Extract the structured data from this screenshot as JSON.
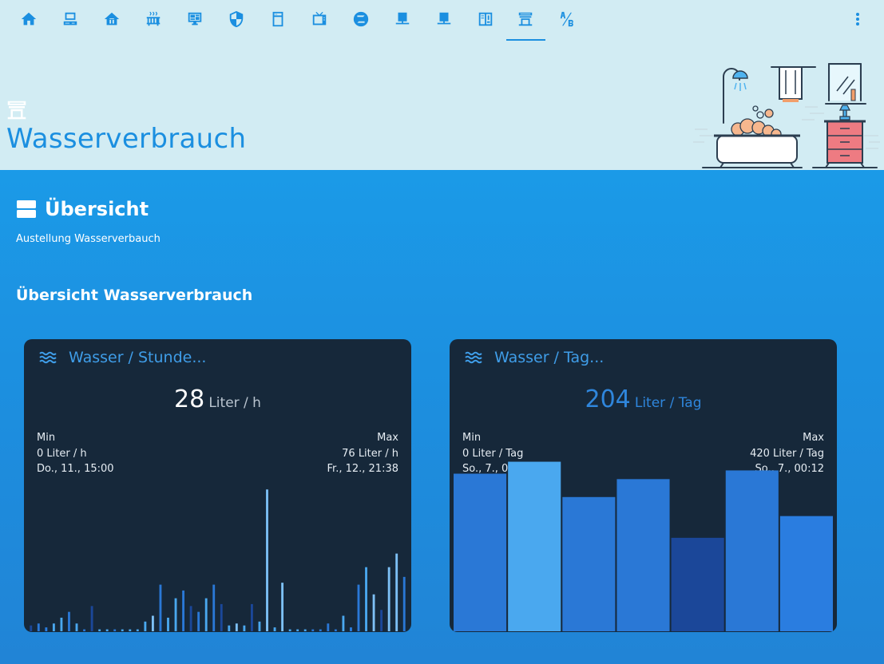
{
  "view": {
    "title": "Wasserverbrauch",
    "icon": "water-tap-icon"
  },
  "tabs": [
    {
      "name": "home-icon"
    },
    {
      "name": "computer-icon"
    },
    {
      "name": "house-icon"
    },
    {
      "name": "radiator-icon"
    },
    {
      "name": "monitor-dashboard-icon"
    },
    {
      "name": "shield-icon"
    },
    {
      "name": "washing-machine-icon"
    },
    {
      "name": "television-icon"
    },
    {
      "name": "zigbee-icon"
    },
    {
      "name": "laptop-icon"
    },
    {
      "name": "laptop-icon-2"
    },
    {
      "name": "panel-icon"
    },
    {
      "name": "water-tap-icon"
    },
    {
      "name": "alpha-ab-icon"
    }
  ],
  "active_tab": 12,
  "section": {
    "title": "Übersicht",
    "subtitle": "Austellung Wasserverbauch",
    "group_title": "Übersicht Wasserverbrauch"
  },
  "colors": {
    "header_bg": "#d2ecf3",
    "accent": "#1b8fe0",
    "card_bg": "#16283a",
    "bar_palette": [
      "#2a78d6",
      "#4aa8ef",
      "#7dc0f5",
      "#1b4799",
      "#2a7de0"
    ]
  },
  "cards": [
    {
      "name": "Wasser / Stunde...",
      "value": "28",
      "unit": "Liter / h",
      "value_color": "#ffffff",
      "unit_color": "#b9c4cf",
      "min_label": "Min",
      "min_value": "0 Liter / h",
      "min_time": "Do., 11., 15:00",
      "max_label": "Max",
      "max_value": "76 Liter / h",
      "max_time": "Fr., 12., 21:38"
    },
    {
      "name": "Wasser / Tag...",
      "value": "204",
      "unit": "Liter / Tag",
      "value_color": "#2f86dc",
      "unit_color": "#2f86dc",
      "min_label": "Min",
      "min_value": "0 Liter / Tag",
      "min_time": "So., 7., 01:00",
      "max_label": "Max",
      "max_value": "420 Liter / Tag",
      "max_time": "So., 7., 00:12"
    }
  ],
  "chart_data": [
    {
      "type": "bar",
      "title": "Wasser / Stunde...",
      "ylim": [
        0,
        76
      ],
      "values": [
        3,
        4,
        2,
        4,
        7,
        10,
        4,
        1,
        13,
        1,
        1,
        1,
        1,
        1,
        1,
        5,
        8,
        24,
        7,
        17,
        21,
        13,
        10,
        17,
        24,
        14,
        3,
        4,
        3,
        14,
        5,
        73,
        2,
        25,
        1,
        1,
        1,
        1,
        1,
        4,
        1,
        8,
        2,
        24,
        33,
        19,
        11,
        33,
        40,
        28
      ],
      "colors": [
        3,
        0,
        4,
        1,
        1,
        0,
        1,
        0,
        3,
        1,
        1,
        0,
        1,
        1,
        1,
        1,
        2,
        0,
        1,
        1,
        0,
        3,
        0,
        1,
        0,
        3,
        1,
        2,
        1,
        3,
        1,
        2,
        1,
        2,
        1,
        1,
        1,
        0,
        0,
        0,
        0,
        1,
        4,
        0,
        1,
        2,
        3,
        2,
        2,
        0
      ]
    },
    {
      "type": "bar",
      "title": "Wasser / Tag...",
      "ylim": [
        0,
        420
      ],
      "values": [
        290,
        312,
        247,
        280,
        172,
        296,
        212
      ],
      "colors": [
        0,
        1,
        0,
        0,
        3,
        0,
        4
      ]
    }
  ]
}
